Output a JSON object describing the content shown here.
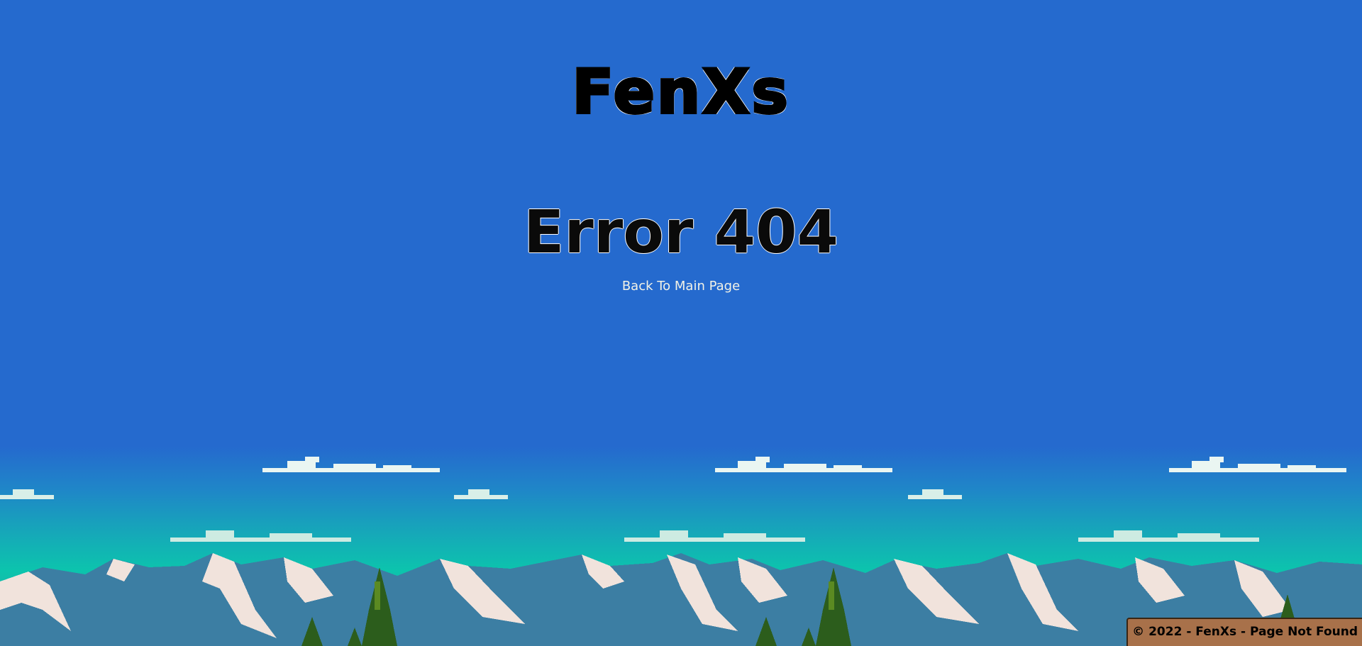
{
  "brand": {
    "logo_text": "FenXs"
  },
  "main": {
    "title": "Error 404",
    "back_link": "Back To Main Page"
  },
  "footer": {
    "text": "© 2022 - FenXs - Page Not Found"
  },
  "colors": {
    "sky": "#256ace",
    "horizon": "#0cc4ad",
    "mountain": "#3b7fa4",
    "snow": "#f4e8e0",
    "tree": "#2d5a1a",
    "footer_bg": "#a8714a"
  }
}
